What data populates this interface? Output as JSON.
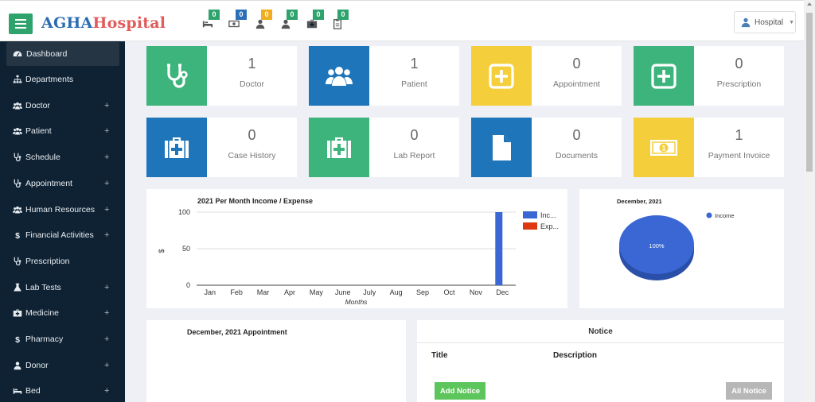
{
  "header": {
    "logo_part1": "AGHA",
    "logo_part2": "Hospital",
    "notifications": [
      {
        "icon": "bed-icon",
        "count": "0",
        "color": "#2ea36c"
      },
      {
        "icon": "money-icon",
        "count": "0",
        "color": "#2a6fb8"
      },
      {
        "icon": "user-icon",
        "count": "0",
        "color": "#f0ad1e"
      },
      {
        "icon": "user-icon",
        "count": "0",
        "color": "#2ea36c"
      },
      {
        "icon": "medkit-icon",
        "count": "0",
        "color": "#2ea36c"
      },
      {
        "icon": "clipboard-icon",
        "count": "0",
        "color": "#2ea36c"
      }
    ],
    "user_label": "Hospital"
  },
  "sidebar": {
    "items": [
      {
        "label": "Dashboard",
        "icon": "dashboard-icon",
        "expandable": false,
        "active": true
      },
      {
        "label": "Departments",
        "icon": "sitemap-icon",
        "expandable": false
      },
      {
        "label": "Doctor",
        "icon": "users-icon",
        "expandable": true
      },
      {
        "label": "Patient",
        "icon": "users-icon",
        "expandable": true
      },
      {
        "label": "Schedule",
        "icon": "stethoscope-icon",
        "expandable": true
      },
      {
        "label": "Appointment",
        "icon": "stethoscope-icon",
        "expandable": true
      },
      {
        "label": "Human Resources",
        "icon": "users-icon",
        "expandable": true
      },
      {
        "label": "Financial Activities",
        "icon": "dollar-icon",
        "expandable": true
      },
      {
        "label": "Prescription",
        "icon": "stethoscope-icon",
        "expandable": false
      },
      {
        "label": "Lab Tests",
        "icon": "flask-icon",
        "expandable": true
      },
      {
        "label": "Medicine",
        "icon": "medkit-icon",
        "expandable": true
      },
      {
        "label": "Pharmacy",
        "icon": "dollar-icon",
        "expandable": true
      },
      {
        "label": "Donor",
        "icon": "user-icon",
        "expandable": true
      },
      {
        "label": "Bed",
        "icon": "bed-icon",
        "expandable": true
      }
    ],
    "plus_symbol": "+"
  },
  "stats": [
    {
      "count": "1",
      "label": "Doctor",
      "icon": "stethoscope-icon",
      "color": "#3db47c"
    },
    {
      "count": "1",
      "label": "Patient",
      "icon": "users-icon",
      "color": "#1f75b9"
    },
    {
      "count": "0",
      "label": "Appointment",
      "icon": "plus-square-icon",
      "color": "#f4cf3b"
    },
    {
      "count": "0",
      "label": "Prescription",
      "icon": "plus-square-icon",
      "color": "#3db47c"
    },
    {
      "count": "0",
      "label": "Case History",
      "icon": "medkit-icon",
      "color": "#1f75b9"
    },
    {
      "count": "0",
      "label": "Lab Report",
      "icon": "medkit-icon",
      "color": "#3db47c"
    },
    {
      "count": "0",
      "label": "Documents",
      "icon": "file-icon",
      "color": "#1f75b9"
    },
    {
      "count": "1",
      "label": "Payment Invoice",
      "icon": "money-icon",
      "color": "#f4cf3b"
    }
  ],
  "chart_data": [
    {
      "type": "bar",
      "title": "2021 Per Month Income / Expense",
      "xlabel": "Months",
      "ylabel": "$",
      "categories": [
        "Jan",
        "Feb",
        "Mar",
        "Apr",
        "May",
        "June",
        "July",
        "Aug",
        "Sep",
        "Oct",
        "Nov",
        "Dec"
      ],
      "series": [
        {
          "name": "Inc...",
          "color": "#3a67d4",
          "values": [
            0,
            0,
            0,
            0,
            0,
            0,
            0,
            0,
            0,
            0,
            0,
            100
          ]
        },
        {
          "name": "Exp...",
          "color": "#dc3912",
          "values": [
            0,
            0,
            0,
            0,
            0,
            0,
            0,
            0,
            0,
            0,
            0,
            0
          ]
        }
      ],
      "ylim": [
        0,
        100
      ],
      "yticks": [
        "0",
        "50",
        "100"
      ],
      "legend": "right",
      "grid": true
    },
    {
      "type": "pie",
      "title": "December, 2021",
      "slices": [
        {
          "label": "Income",
          "value": 100,
          "color": "#3a67d4"
        }
      ],
      "slice_label": "100%",
      "legend": "top-right",
      "style": "3d"
    }
  ],
  "appointments_panel": {
    "title": "December, 2021 Appointment"
  },
  "notice_panel": {
    "title": "Notice",
    "columns": [
      "Title",
      "Description"
    ],
    "add_button": "Add Notice",
    "all_button": "All Notice"
  }
}
